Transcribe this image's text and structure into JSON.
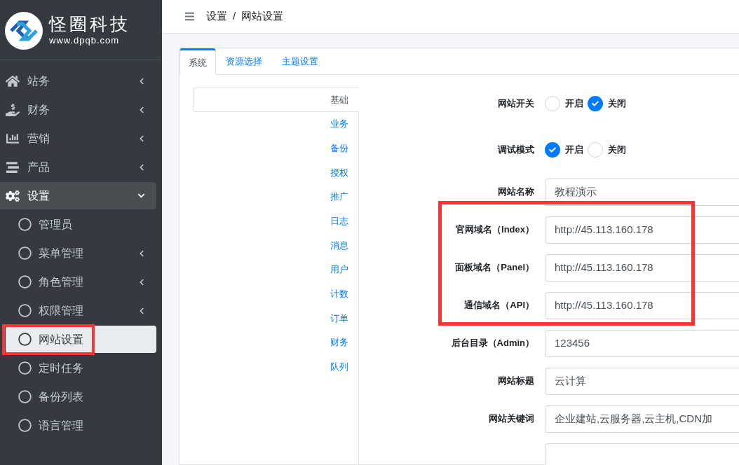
{
  "brand": {
    "name": "怪圈科技",
    "url": "www.dpqb.com"
  },
  "sidebar": {
    "items": [
      {
        "label": "站务",
        "expanded": false
      },
      {
        "label": "财务",
        "expanded": false
      },
      {
        "label": "营销",
        "expanded": false
      },
      {
        "label": "产品",
        "expanded": false
      },
      {
        "label": "设置",
        "expanded": true,
        "children": [
          {
            "label": "管理员",
            "has_submenu": false,
            "selected": false,
            "annotated": false
          },
          {
            "label": "菜单管理",
            "has_submenu": true,
            "selected": false,
            "annotated": false
          },
          {
            "label": "角色管理",
            "has_submenu": true,
            "selected": false,
            "annotated": false
          },
          {
            "label": "权限管理",
            "has_submenu": true,
            "selected": false,
            "annotated": false
          },
          {
            "label": "网站设置",
            "has_submenu": false,
            "selected": true,
            "annotated": true
          },
          {
            "label": "定时任务",
            "has_submenu": false,
            "selected": false,
            "annotated": false
          },
          {
            "label": "备份列表",
            "has_submenu": false,
            "selected": false,
            "annotated": false
          },
          {
            "label": "语言管理",
            "has_submenu": false,
            "selected": false,
            "annotated": false
          }
        ]
      }
    ]
  },
  "breadcrumb": [
    "设置",
    "/",
    "网站设置"
  ],
  "tabs": [
    {
      "label": "系统",
      "selected": true
    },
    {
      "label": "资源选择",
      "selected": false
    },
    {
      "label": "主题设置",
      "selected": false
    }
  ],
  "sections": [
    {
      "label": "基础",
      "selected": true
    },
    {
      "label": "业务",
      "selected": false
    },
    {
      "label": "备份",
      "selected": false
    },
    {
      "label": "授权",
      "selected": false
    },
    {
      "label": "推广",
      "selected": false
    },
    {
      "label": "日志",
      "selected": false
    },
    {
      "label": "消息",
      "selected": false
    },
    {
      "label": "用户",
      "selected": false
    },
    {
      "label": "计数",
      "selected": false
    },
    {
      "label": "订单",
      "selected": false
    },
    {
      "label": "财务",
      "selected": false
    },
    {
      "label": "队列",
      "selected": false
    }
  ],
  "form": [
    {
      "kind": "radio",
      "label": "网站开关",
      "annotated": false,
      "options": [
        {
          "label": "开启",
          "selected": false
        },
        {
          "label": "关闭",
          "selected": true
        }
      ]
    },
    {
      "kind": "radio",
      "label": "调试模式",
      "annotated": false,
      "options": [
        {
          "label": "开启",
          "selected": true
        },
        {
          "label": "关闭",
          "selected": false
        }
      ]
    },
    {
      "kind": "input",
      "label": "网站名称",
      "value": "教程演示",
      "annotated": false
    },
    {
      "kind": "input",
      "label": "官网域名（Index）",
      "value": "http://45.113.160.178",
      "annotated": true
    },
    {
      "kind": "input",
      "label": "面板域名（Panel）",
      "value": "http://45.113.160.178",
      "annotated": true
    },
    {
      "kind": "input",
      "label": "通信域名（API）",
      "value": "http://45.113.160.178",
      "annotated": true
    },
    {
      "kind": "input",
      "label": "后台目录（Admin）",
      "value": "123456",
      "annotated": false
    },
    {
      "kind": "input",
      "label": "网站标题",
      "value": "云计算",
      "annotated": false
    },
    {
      "kind": "input",
      "label": "网站关键词",
      "value": "企业建站,云服务器,云主机,CDN加",
      "annotated": false
    },
    {
      "kind": "input",
      "annotated": false
    }
  ]
}
